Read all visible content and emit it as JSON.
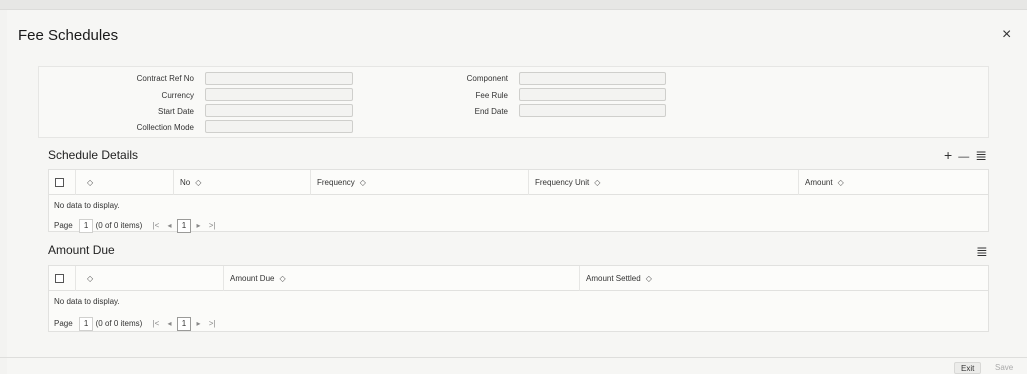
{
  "dialog": {
    "title": "Fee Schedules",
    "close_icon": "×"
  },
  "form": {
    "contract_ref_no_label": "Contract Ref No",
    "currency_label": "Currency",
    "start_date_label": "Start Date",
    "collection_mode_label": "Collection Mode",
    "component_label": "Component",
    "fee_rule_label": "Fee Rule",
    "end_date_label": "End Date",
    "contract_ref_no": "",
    "currency": "",
    "start_date": "",
    "collection_mode": "",
    "component": "",
    "fee_rule": "",
    "end_date": ""
  },
  "schedule": {
    "title": "Schedule Details",
    "add_icon": "+",
    "remove_icon": "—",
    "columns_icon": "≣",
    "columns": [
      "",
      "No",
      "Frequency",
      "Frequency Unit",
      "Amount"
    ],
    "sort_icon": "◇",
    "empty": "No data to display.",
    "page_label": "Page",
    "page_num": "1",
    "items_text": "(0 of 0 items)",
    "first_icon": "|<",
    "prev_icon": "◂",
    "current_page": "1",
    "next_icon": "▸",
    "last_icon": ">|"
  },
  "amount_due": {
    "title": "Amount Due",
    "columns_icon": "≣",
    "columns": [
      "",
      "Amount Due",
      "Amount Settled"
    ],
    "sort_icon": "◇",
    "empty": "No data to display.",
    "page_label": "Page",
    "page_num": "1",
    "items_text": "(0 of 0 items)",
    "first_icon": "|<",
    "prev_icon": "◂",
    "current_page": "1",
    "next_icon": "▸",
    "last_icon": ">|"
  },
  "footer": {
    "exit_label": "Exit",
    "save_label": "Save"
  }
}
